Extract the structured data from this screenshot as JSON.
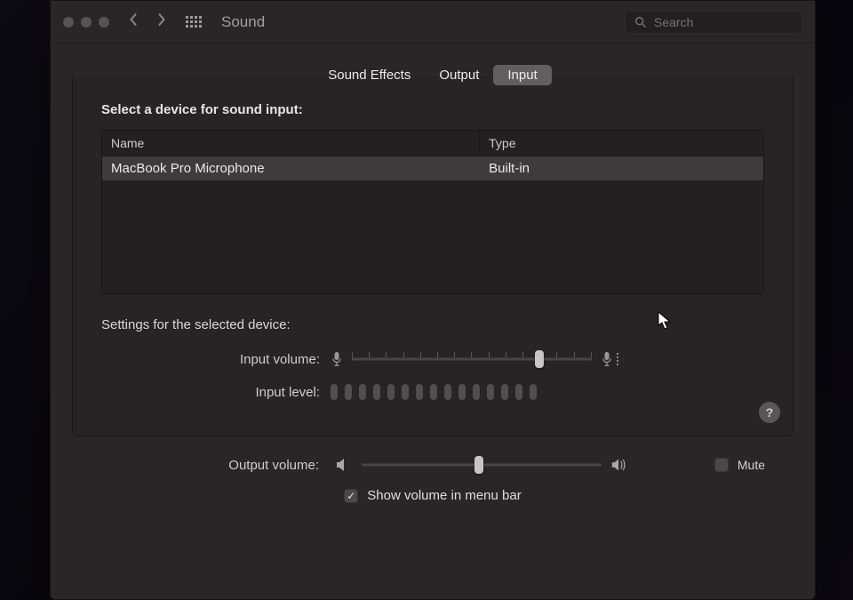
{
  "toolbar": {
    "title": "Sound",
    "search_placeholder": "Search"
  },
  "tabs": [
    {
      "label": "Sound Effects",
      "active": false
    },
    {
      "label": "Output",
      "active": false
    },
    {
      "label": "Input",
      "active": true
    }
  ],
  "panel": {
    "heading": "Select a device for sound input:",
    "columns": {
      "name": "Name",
      "type": "Type"
    },
    "devices": [
      {
        "name": "MacBook Pro Microphone",
        "type": "Built-in"
      }
    ],
    "settings_heading": "Settings for the selected device:",
    "input_volume_label": "Input volume:",
    "input_volume_percent": 78,
    "input_level_label": "Input level:",
    "input_level_segments": 15,
    "help_label": "?"
  },
  "footer": {
    "output_volume_label": "Output volume:",
    "output_volume_percent": 49,
    "mute_label": "Mute",
    "mute_checked": false,
    "show_volume_label": "Show volume in menu bar",
    "show_volume_checked": true
  }
}
